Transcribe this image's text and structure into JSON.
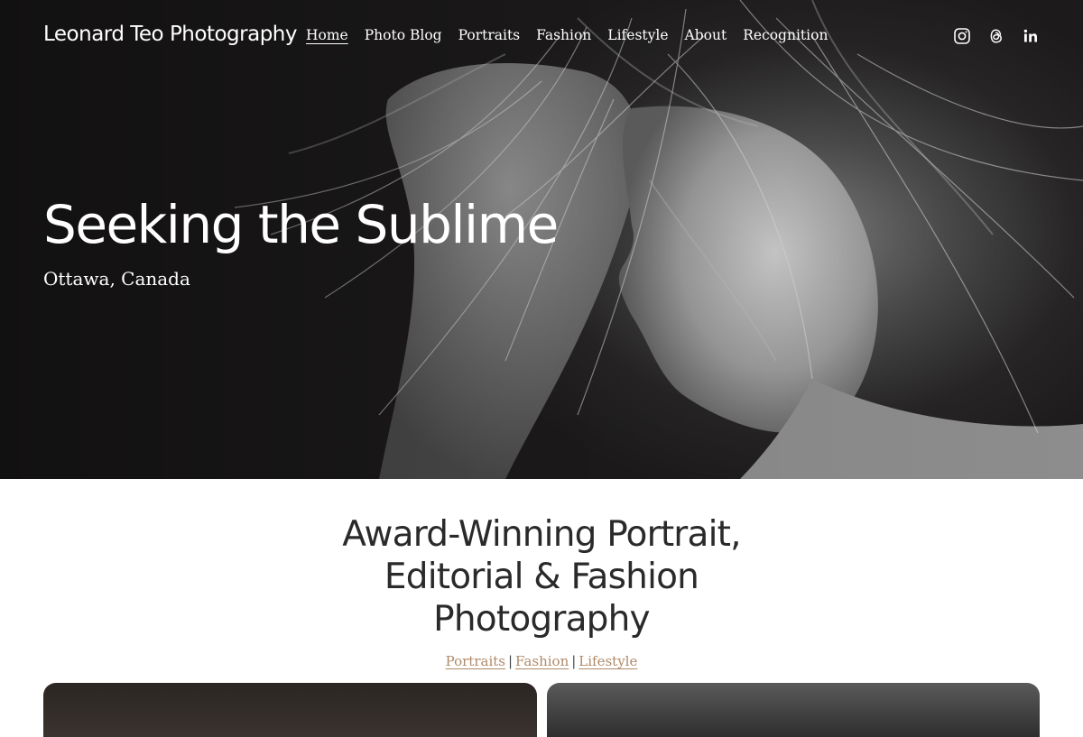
{
  "site": {
    "title": "Leonard Teo Photography"
  },
  "nav": {
    "items": [
      {
        "label": "Home",
        "active": true
      },
      {
        "label": "Photo Blog"
      },
      {
        "label": "Portraits"
      },
      {
        "label": "Fashion"
      },
      {
        "label": "Lifestyle"
      },
      {
        "label": "About"
      },
      {
        "label": "Recognition"
      }
    ]
  },
  "socials": [
    "instagram-icon",
    "threads-icon",
    "linkedin-icon"
  ],
  "hero": {
    "title": "Seeking the Sublime",
    "subtitle": "Ottawa, Canada"
  },
  "intro": {
    "title_lines": [
      "Award-Winning Portrait,",
      "Editorial & Fashion",
      "Photography"
    ],
    "links": [
      "Portraits",
      "Fashion",
      "Lifestyle"
    ],
    "separator": "|"
  },
  "colors": {
    "link_accent": "#b08a68",
    "hero_bg": "#1c1a1b",
    "heading": "#2a2a2a"
  }
}
